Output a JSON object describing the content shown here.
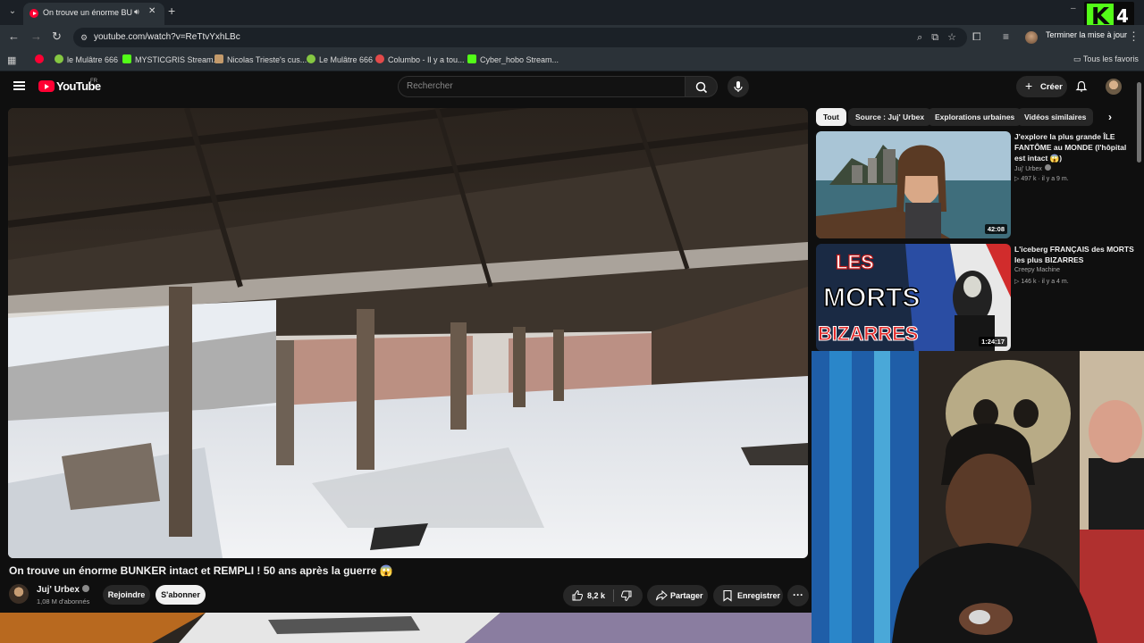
{
  "browser": {
    "tab": {
      "title": "On trouve un énorme BUNKER intact et REMPLI ! 50 ans après la guerre"
    },
    "address": {
      "url": "youtube.com/watch?v=ReTtvYxhLBc"
    },
    "update_button": "Terminer la mise à jour",
    "bookmarks": [
      {
        "label": "",
        "icon": "youtube"
      },
      {
        "label": "le Mulâtre 666",
        "icon": "rumble"
      },
      {
        "label": "MYSTICGRIS Stream...",
        "icon": "kick"
      },
      {
        "label": "Nicolas Trieste's cus...",
        "icon": "cat"
      },
      {
        "label": "Le Mulâtre 666",
        "icon": "rumble"
      },
      {
        "label": "Columbo - Il y a tou...",
        "icon": "columbo"
      },
      {
        "label": "Cyber_hobo Stream...",
        "icon": "kick"
      }
    ],
    "all_bookmarks": "Tous les favoris"
  },
  "overlay": {
    "kick_number": "4"
  },
  "youtube": {
    "logo_text": "YouTube",
    "region": "FR",
    "search_placeholder": "Rechercher",
    "create_label": "Créer",
    "video": {
      "title": "On trouve un énorme BUNKER intact et REMPLI ! 50 ans après la guerre 😱",
      "channel": "Juj' Urbex",
      "subscribers": "1,08 M d'abonnés",
      "join_label": "Rejoindre",
      "subscribe_label": "S'abonner",
      "likes": "8,2 k",
      "share_label": "Partager",
      "save_label": "Enregistrer"
    },
    "chips": [
      "Tout",
      "Source : Juj' Urbex",
      "Explorations urbaines",
      "Vidéos similaires"
    ],
    "recommendations": [
      {
        "title": "J'explore la plus grande ÎLE FANTÔME au MONDE (l'hôpital est intact 😱)",
        "channel": "Juj' Urbex",
        "views": "497 k",
        "age": "il y a 9 m.",
        "duration": "42:08"
      },
      {
        "title": "L'iceberg FRANÇAIS des MORTS les plus BIZARRES",
        "channel": "Creepy Machine",
        "views": "146 k",
        "age": "il y a 4 m.",
        "duration": "1:24:17",
        "thumb_text": [
          "LES",
          "MORTS",
          "BIZARRES"
        ]
      }
    ]
  },
  "colors": {
    "youtube_red": "#ff0033",
    "kick_green": "#53fc18"
  }
}
